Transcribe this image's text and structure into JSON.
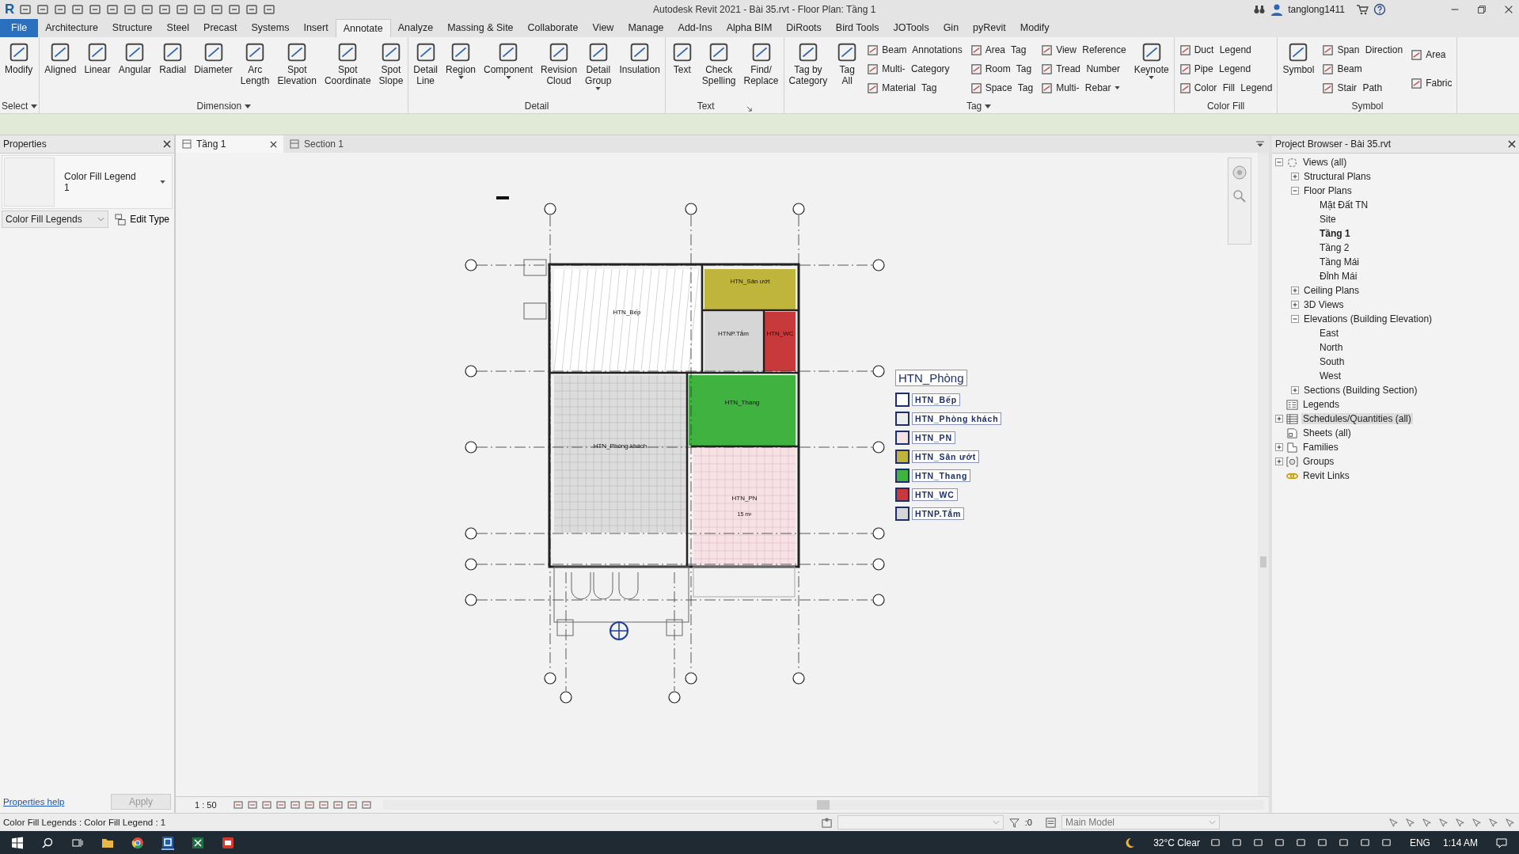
{
  "title_bar": {
    "logo": "R",
    "title": "Autodesk Revit 2021 - Bài 35.rvt - Floor Plan: Tầng 1",
    "user": "tanglong1411"
  },
  "menu_tabs": [
    {
      "label": "File",
      "kind": "file",
      "selected": false
    },
    {
      "label": "Architecture",
      "kind": "tab",
      "selected": false
    },
    {
      "label": "Structure",
      "kind": "tab",
      "selected": false
    },
    {
      "label": "Steel",
      "kind": "tab",
      "selected": false
    },
    {
      "label": "Precast",
      "kind": "tab",
      "selected": false
    },
    {
      "label": "Systems",
      "kind": "tab",
      "selected": false
    },
    {
      "label": "Insert",
      "kind": "tab",
      "selected": false
    },
    {
      "label": "Annotate",
      "kind": "tab",
      "selected": true
    },
    {
      "label": "Analyze",
      "kind": "tab",
      "selected": false
    },
    {
      "label": "Massing & Site",
      "kind": "tab",
      "selected": false
    },
    {
      "label": "Collaborate",
      "kind": "tab",
      "selected": false
    },
    {
      "label": "View",
      "kind": "tab",
      "selected": false
    },
    {
      "label": "Manage",
      "kind": "tab",
      "selected": false
    },
    {
      "label": "Add-Ins",
      "kind": "tab",
      "selected": false
    },
    {
      "label": "Alpha BIM",
      "kind": "tab",
      "selected": false
    },
    {
      "label": "DiRoots",
      "kind": "tab",
      "selected": false
    },
    {
      "label": "Bird Tools",
      "kind": "tab",
      "selected": false
    },
    {
      "label": "JOTools",
      "kind": "tab",
      "selected": false
    },
    {
      "label": "Gin",
      "kind": "tab",
      "selected": false
    },
    {
      "label": "pyRevit",
      "kind": "tab",
      "selected": false
    },
    {
      "label": "Modify",
      "kind": "tab",
      "selected": false
    }
  ],
  "ribbon": {
    "panels": [
      {
        "label": "Select",
        "menu": true,
        "launcher": false,
        "groups": [
          {
            "kind": "large",
            "label": "Modify",
            "caret": false
          }
        ]
      },
      {
        "label": "Dimension",
        "menu": true,
        "launcher": false,
        "groups": [
          {
            "kind": "large",
            "label": "Aligned",
            "caret": false
          },
          {
            "kind": "large",
            "label": "Linear",
            "caret": false
          },
          {
            "kind": "large",
            "label": "Angular",
            "caret": false
          },
          {
            "kind": "large",
            "label": "Radial",
            "caret": false
          },
          {
            "kind": "large",
            "label": "Diameter",
            "caret": false
          },
          {
            "kind": "large",
            "label": "Arc Length",
            "caret": false
          },
          {
            "kind": "large",
            "label": "Spot Elevation",
            "caret": false
          },
          {
            "kind": "large",
            "label": "Spot Coordinate",
            "caret": false
          },
          {
            "kind": "large",
            "label": "Spot Slope",
            "caret": false
          }
        ]
      },
      {
        "label": "Detail",
        "menu": false,
        "launcher": false,
        "groups": [
          {
            "kind": "large",
            "label": "Detail Line",
            "caret": false
          },
          {
            "kind": "large",
            "label": "Region",
            "caret": true
          },
          {
            "kind": "large",
            "label": "Component",
            "caret": true
          },
          {
            "kind": "large",
            "label": "Revision Cloud",
            "caret": false
          },
          {
            "kind": "large",
            "label": "Detail Group",
            "caret": true
          },
          {
            "kind": "large",
            "label": "Insulation",
            "caret": false
          }
        ]
      },
      {
        "label": "Text",
        "menu": false,
        "launcher": true,
        "groups": [
          {
            "kind": "large",
            "label": "Text",
            "caret": false
          },
          {
            "kind": "large",
            "label": "Check Spelling",
            "caret": false
          },
          {
            "kind": "large",
            "label": "Find/ Replace",
            "caret": false
          }
        ]
      },
      {
        "label": "Tag",
        "menu": true,
        "launcher": false,
        "groups": [
          {
            "kind": "large",
            "label": "Tag by Category",
            "caret": false
          },
          {
            "kind": "large",
            "label": "Tag All",
            "caret": false
          },
          {
            "kind": "stack",
            "items": [
              {
                "label": "Beam Annotations",
                "caret": false
              },
              {
                "label": "Multi- Category",
                "caret": false
              },
              {
                "label": "Material Tag",
                "caret": false
              }
            ]
          },
          {
            "kind": "stack",
            "items": [
              {
                "label": "Area Tag",
                "caret": false
              },
              {
                "label": "Room Tag",
                "caret": false
              },
              {
                "label": "Space Tag",
                "caret": false
              }
            ]
          },
          {
            "kind": "stack",
            "items": [
              {
                "label": "View Reference",
                "caret": false
              },
              {
                "label": "Tread Number",
                "caret": false
              },
              {
                "label": "Multi- Rebar",
                "caret": true
              }
            ]
          },
          {
            "kind": "large",
            "label": "Keynote",
            "caret": true
          }
        ]
      },
      {
        "label": "Color Fill",
        "menu": false,
        "launcher": false,
        "groups": [
          {
            "kind": "stack",
            "items": [
              {
                "label": "Duct Legend",
                "caret": false
              },
              {
                "label": "Pipe Legend",
                "caret": false
              },
              {
                "label": "Color Fill Legend",
                "caret": false
              }
            ]
          }
        ]
      },
      {
        "label": "Symbol",
        "menu": false,
        "launcher": false,
        "groups": [
          {
            "kind": "large",
            "label": "Symbol",
            "caret": false
          },
          {
            "kind": "stack",
            "items": [
              {
                "label": "Span Direction",
                "caret": false
              },
              {
                "label": "Beam",
                "caret": false
              },
              {
                "label": "Stair Path",
                "caret": false
              }
            ]
          },
          {
            "kind": "stack",
            "items": [
              {
                "label": "Area",
                "caret": false
              },
              {
                "label": "Fabric",
                "caret": false
              }
            ]
          }
        ]
      }
    ]
  },
  "properties": {
    "title": "Properties",
    "type_name": "Color Fill Legend",
    "type_sub": "1",
    "category": "Color Fill Legends",
    "edit_type": "Edit Type",
    "help_link": "Properties help",
    "apply": "Apply",
    "apply_disabled": true
  },
  "view_tabs": [
    {
      "label": "Tầng 1",
      "selected": true
    },
    {
      "label": "Section 1",
      "selected": false
    }
  ],
  "rooms": [
    {
      "name": "HTN_Bếp",
      "color": "#ffffff"
    },
    {
      "name": "HTN_Sân ướt",
      "color": "#bfb43c"
    },
    {
      "name": "HTNP.Tắm",
      "color": "#d6d6d6"
    },
    {
      "name": "HTN_WC",
      "color": "#c8393c"
    },
    {
      "name": "HTN_Phòng khách",
      "color": "#dcdcdc"
    },
    {
      "name": "HTN_Thang",
      "color": "#3fb23f"
    },
    {
      "name": "HTN_PN",
      "color": "#f6e2e5",
      "area": "15 m²"
    }
  ],
  "legend": {
    "title": "HTN_Phòng",
    "items": [
      {
        "label": "HTN_Bếp",
        "color": "#ffffff"
      },
      {
        "label": "HTN_Phòng khách",
        "color": "#eeeeee"
      },
      {
        "label": "HTN_PN",
        "color": "#f6e2e5"
      },
      {
        "label": "HTN_Sân ướt",
        "color": "#bfb43c"
      },
      {
        "label": "HTN_Thang",
        "color": "#3fb23f"
      },
      {
        "label": "HTN_WC",
        "color": "#c8393c"
      },
      {
        "label": "HTNP.Tắm",
        "color": "#d6d6d6"
      }
    ]
  },
  "view_control": {
    "scale": "1 : 50"
  },
  "project_browser": {
    "title": "Project Browser - Bài 35.rvt",
    "tree": [
      {
        "label": "Views (all)",
        "kind": "views",
        "expanded": true,
        "children": [
          {
            "label": "Structural Plans",
            "expanded": false
          },
          {
            "label": "Floor Plans",
            "expanded": true,
            "children": [
              {
                "label": "Mặt Đất TN",
                "current": false
              },
              {
                "label": "Site",
                "current": false
              },
              {
                "label": "Tầng 1",
                "current": true
              },
              {
                "label": "Tầng 2",
                "current": false
              },
              {
                "label": "Tầng Mái",
                "current": false
              },
              {
                "label": "Đỉnh Mái",
                "current": false
              }
            ]
          },
          {
            "label": "Ceiling Plans",
            "expanded": false
          },
          {
            "label": "3D Views",
            "expanded": false
          },
          {
            "label": "Elevations (Building Elevation)",
            "expanded": true,
            "children": [
              {
                "label": "East",
                "current": false
              },
              {
                "label": "North",
                "current": false
              },
              {
                "label": "South",
                "current": false
              },
              {
                "label": "West",
                "current": false
              }
            ]
          },
          {
            "label": "Sections (Building Section)",
            "expanded": false
          }
        ]
      },
      {
        "label": "Legends",
        "kind": "legends"
      },
      {
        "label": "Schedules/Quantities (all)",
        "kind": "schedules",
        "expanded": false,
        "highlighted": true
      },
      {
        "label": "Sheets (all)",
        "kind": "sheets"
      },
      {
        "label": "Families",
        "kind": "families",
        "expanded": false
      },
      {
        "label": "Groups",
        "kind": "groups",
        "expanded": false
      },
      {
        "label": "Revit Links",
        "kind": "links"
      }
    ]
  },
  "status_bar": {
    "message": "Color Fill Legends : Color Fill Legend : 1",
    "selection_count": ":0",
    "workset": "Main Model"
  },
  "taskbar": {
    "weather": "32°C Clear",
    "language": "ENG",
    "time": "1:14 AM"
  }
}
